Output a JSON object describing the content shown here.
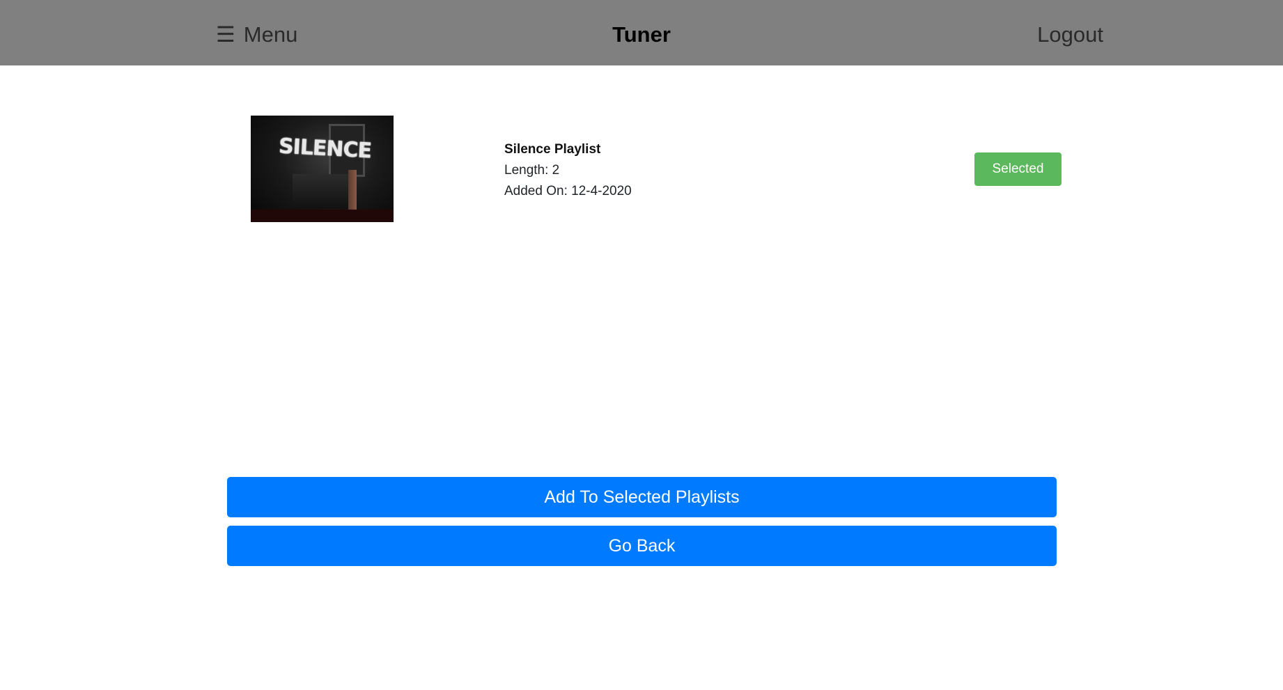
{
  "header": {
    "menu_icon": "☰",
    "menu_label": "Menu",
    "brand": "Tuner",
    "logout_label": "Logout",
    "background_color": "#808080"
  },
  "playlists": [
    {
      "thumbnail_text": "SILENCE",
      "name": "Silence Playlist",
      "length_text": "Length: 2",
      "added_text": "Added On: 12-4-2020",
      "status_label": "Selected",
      "status_color": "#5cb85c"
    }
  ],
  "actions": {
    "add_label": "Add To Selected Playlists",
    "back_label": "Go Back",
    "button_color": "#007bff"
  }
}
